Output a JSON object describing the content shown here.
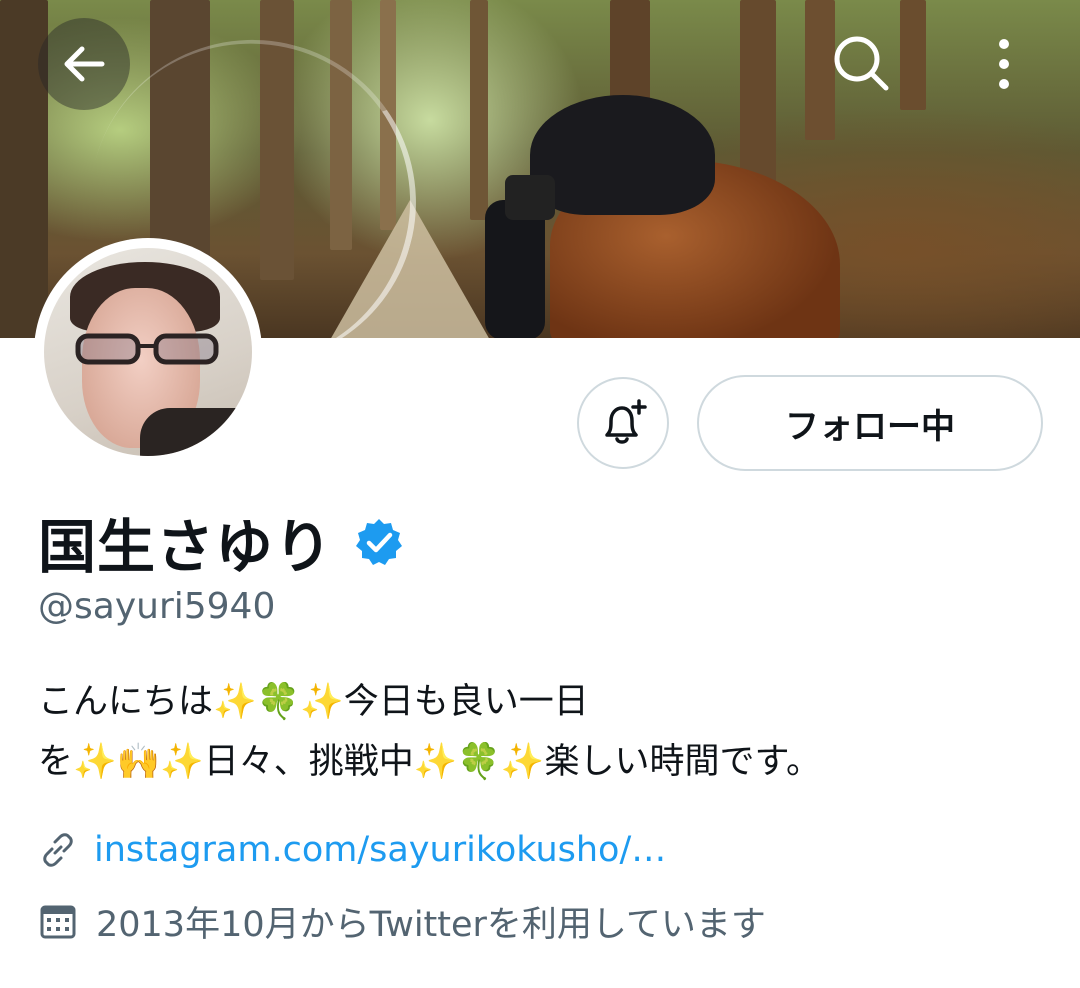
{
  "header": {
    "back_icon": "arrow-left-icon",
    "search_icon": "search-icon",
    "more_icon": "more-vertical-icon"
  },
  "actions": {
    "notify_icon": "bell-plus-icon",
    "follow_label": "フォロー中"
  },
  "profile": {
    "name": "国生さゆり",
    "verified_icon": "verified-badge-icon",
    "handle": "@sayuri5940",
    "bio_line1": "こんにちは✨🍀✨今日も良い一日",
    "bio_line2": "を✨🙌✨日々、挑戦中✨🍀✨楽しい時間です。",
    "link_icon": "link-icon",
    "link_text": "instagram.com/sayurikokusho/…",
    "joined_icon": "calendar-icon",
    "joined_text": "2013年10月からTwitterを利用しています"
  },
  "colors": {
    "accent": "#1d9bf0",
    "secondary_text": "#536471",
    "border": "#cfd9de"
  }
}
